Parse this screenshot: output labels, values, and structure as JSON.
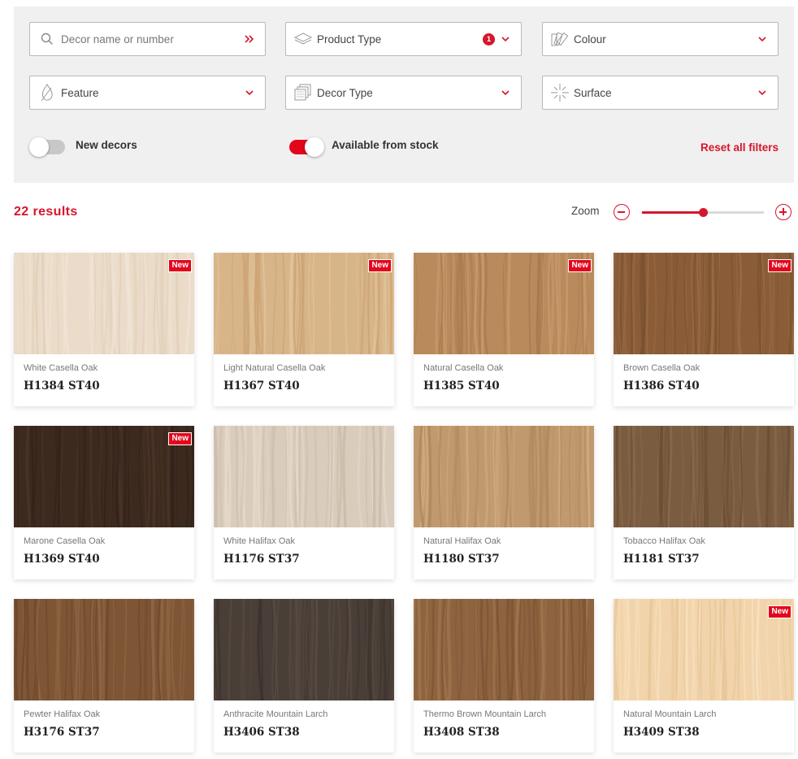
{
  "filters": {
    "search": {
      "placeholder": "Decor name or number",
      "icon": "search-icon",
      "submit_icon": "double-chevron-right-icon"
    },
    "product_type": {
      "label": "Product Type",
      "badge": "1",
      "icon": "layers-icon"
    },
    "colour": {
      "label": "Colour",
      "icon": "colour-swatch-fan-icon"
    },
    "feature": {
      "label": "Feature",
      "icon": "leaf-drop-icon"
    },
    "decor_type": {
      "label": "Decor Type",
      "icon": "stacked-cards-icon"
    },
    "surface": {
      "label": "Surface",
      "icon": "sparkle-icon"
    },
    "new_decors": {
      "label": "New decors",
      "on": false
    },
    "available_from_stock": {
      "label": "Available from stock",
      "on": true
    },
    "reset_label": "Reset all filters"
  },
  "results": {
    "count_label": "22 results"
  },
  "zoom": {
    "label": "Zoom",
    "level": 0.5
  },
  "colors": {
    "accent": "#d6162c",
    "panel": "#f0f0f0"
  },
  "products": [
    {
      "name": "White Casella Oak",
      "code": "H1384 ST40",
      "new": true,
      "tag": "New",
      "colors": [
        "#ebdcc9",
        "#e2d0bb",
        "#f0e4d5"
      ]
    },
    {
      "name": "Light Natural Casella Oak",
      "code": "H1367 ST40",
      "new": true,
      "tag": "New",
      "colors": [
        "#d8b588",
        "#cda475",
        "#e1c39b"
      ]
    },
    {
      "name": "Natural Casella Oak",
      "code": "H1385 ST40",
      "new": true,
      "tag": "New",
      "colors": [
        "#b98a5c",
        "#a97a4d",
        "#c69a6c"
      ]
    },
    {
      "name": "Brown Casella Oak",
      "code": "H1386 ST40",
      "new": true,
      "tag": "New",
      "colors": [
        "#8a5d38",
        "#7a5030",
        "#9a6c45"
      ]
    },
    {
      "name": "Marone Casella Oak",
      "code": "H1369 ST40",
      "new": true,
      "tag": "New",
      "colors": [
        "#3d2a1f",
        "#32221a",
        "#4a3426"
      ]
    },
    {
      "name": "White Halifax Oak",
      "code": "H1176 ST37",
      "new": false,
      "tag": "",
      "colors": [
        "#d9ccbc",
        "#cbbcaa",
        "#e4d8ca"
      ]
    },
    {
      "name": "Natural Halifax Oak",
      "code": "H1180 ST37",
      "new": false,
      "tag": "",
      "colors": [
        "#c09a6e",
        "#b08a5e",
        "#cfab80"
      ]
    },
    {
      "name": "Tobacco Halifax Oak",
      "code": "H1181 ST37",
      "new": false,
      "tag": "",
      "colors": [
        "#7a5c40",
        "#6a4e35",
        "#8a6b4d"
      ]
    },
    {
      "name": "Pewter Halifax Oak",
      "code": "H3176 ST37",
      "new": false,
      "tag": "",
      "colors": [
        "#7e5636",
        "#6d482c",
        "#8e6643"
      ]
    },
    {
      "name": "Anthracite Mountain Larch",
      "code": "H3406 ST38",
      "new": false,
      "tag": "",
      "colors": [
        "#4a3f38",
        "#3d332d",
        "#574b43"
      ]
    },
    {
      "name": "Thermo Brown Mountain Larch",
      "code": "H3408 ST38",
      "new": false,
      "tag": "",
      "colors": [
        "#8e6440",
        "#7d5535",
        "#9f754f"
      ]
    },
    {
      "name": "Natural Mountain Larch",
      "code": "H3409 ST38",
      "new": true,
      "tag": "New",
      "colors": [
        "#f1d4ab",
        "#e8c698",
        "#f7dfbd"
      ]
    }
  ]
}
